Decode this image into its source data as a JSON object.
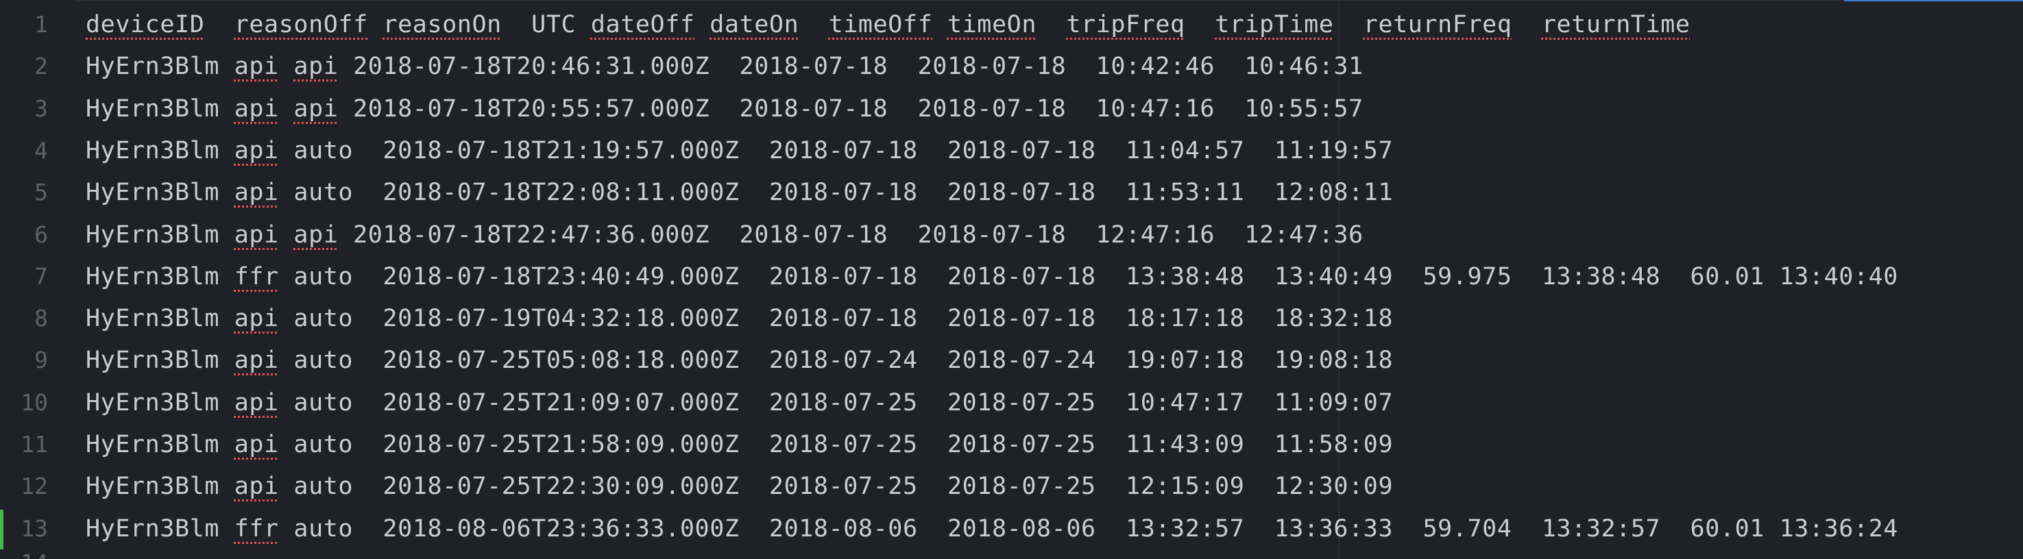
{
  "editor": {
    "lines": [
      {
        "num": "1",
        "modified": false,
        "tokens": [
          {
            "t": "deviceID",
            "s": true
          },
          {
            "t": "  ",
            "s": false
          },
          {
            "t": "reasonOff",
            "s": true
          },
          {
            "t": " ",
            "s": false
          },
          {
            "t": "reasonOn",
            "s": true
          },
          {
            "t": "  UTC ",
            "s": false
          },
          {
            "t": "dateOff",
            "s": true
          },
          {
            "t": " ",
            "s": false
          },
          {
            "t": "dateOn",
            "s": true
          },
          {
            "t": "  ",
            "s": false
          },
          {
            "t": "timeOff",
            "s": true
          },
          {
            "t": " ",
            "s": false
          },
          {
            "t": "timeOn",
            "s": true
          },
          {
            "t": "  ",
            "s": false
          },
          {
            "t": "tripFreq",
            "s": true
          },
          {
            "t": "  ",
            "s": false
          },
          {
            "t": "tripTime",
            "s": true
          },
          {
            "t": "  ",
            "s": false
          },
          {
            "t": "returnFreq",
            "s": true
          },
          {
            "t": "  ",
            "s": false
          },
          {
            "t": "returnTime",
            "s": true
          }
        ]
      },
      {
        "num": "2",
        "modified": false,
        "tokens": [
          {
            "t": "HyErn3Blm",
            "s": false
          },
          {
            "t": " ",
            "s": false
          },
          {
            "t": "api",
            "s": true
          },
          {
            "t": " ",
            "s": false
          },
          {
            "t": "api",
            "s": true
          },
          {
            "t": " 2018-07-18T20:46:31.000Z  2018-07-18  2018-07-18  10:42:46  10:46:31",
            "s": false
          }
        ]
      },
      {
        "num": "3",
        "modified": false,
        "tokens": [
          {
            "t": "HyErn3Blm",
            "s": false
          },
          {
            "t": " ",
            "s": false
          },
          {
            "t": "api",
            "s": true
          },
          {
            "t": " ",
            "s": false
          },
          {
            "t": "api",
            "s": true
          },
          {
            "t": " 2018-07-18T20:55:57.000Z  2018-07-18  2018-07-18  10:47:16  10:55:57",
            "s": false
          }
        ]
      },
      {
        "num": "4",
        "modified": false,
        "tokens": [
          {
            "t": "HyErn3Blm",
            "s": false
          },
          {
            "t": " ",
            "s": false
          },
          {
            "t": "api",
            "s": true
          },
          {
            "t": " auto  2018-07-18T21:19:57.000Z  2018-07-18  2018-07-18  11:04:57  11:19:57",
            "s": false
          }
        ]
      },
      {
        "num": "5",
        "modified": false,
        "tokens": [
          {
            "t": "HyErn3Blm",
            "s": false
          },
          {
            "t": " ",
            "s": false
          },
          {
            "t": "api",
            "s": true
          },
          {
            "t": " auto  2018-07-18T22:08:11.000Z  2018-07-18  2018-07-18  11:53:11  12:08:11",
            "s": false
          }
        ]
      },
      {
        "num": "6",
        "modified": false,
        "tokens": [
          {
            "t": "HyErn3Blm",
            "s": false
          },
          {
            "t": " ",
            "s": false
          },
          {
            "t": "api",
            "s": true
          },
          {
            "t": " ",
            "s": false
          },
          {
            "t": "api",
            "s": true
          },
          {
            "t": " 2018-07-18T22:47:36.000Z  2018-07-18  2018-07-18  12:47:16  12:47:36",
            "s": false
          }
        ]
      },
      {
        "num": "7",
        "modified": false,
        "tokens": [
          {
            "t": "HyErn3Blm",
            "s": false
          },
          {
            "t": " ",
            "s": false
          },
          {
            "t": "ffr",
            "s": true
          },
          {
            "t": " auto  2018-07-18T23:40:49.000Z  2018-07-18  2018-07-18  13:38:48  13:40:49  59.975  13:38:48  60.01 13:40:40",
            "s": false
          }
        ]
      },
      {
        "num": "8",
        "modified": false,
        "tokens": [
          {
            "t": "HyErn3Blm",
            "s": false
          },
          {
            "t": " ",
            "s": false
          },
          {
            "t": "api",
            "s": true
          },
          {
            "t": " auto  2018-07-19T04:32:18.000Z  2018-07-18  2018-07-18  18:17:18  18:32:18",
            "s": false
          }
        ]
      },
      {
        "num": "9",
        "modified": false,
        "tokens": [
          {
            "t": "HyErn3Blm",
            "s": false
          },
          {
            "t": " ",
            "s": false
          },
          {
            "t": "api",
            "s": true
          },
          {
            "t": " auto  2018-07-25T05:08:18.000Z  2018-07-24  2018-07-24  19:07:18  19:08:18",
            "s": false
          }
        ]
      },
      {
        "num": "10",
        "modified": false,
        "tokens": [
          {
            "t": "HyErn3Blm",
            "s": false
          },
          {
            "t": " ",
            "s": false
          },
          {
            "t": "api",
            "s": true
          },
          {
            "t": " auto  2018-07-25T21:09:07.000Z  2018-07-25  2018-07-25  10:47:17  11:09:07",
            "s": false
          }
        ]
      },
      {
        "num": "11",
        "modified": false,
        "tokens": [
          {
            "t": "HyErn3Blm",
            "s": false
          },
          {
            "t": " ",
            "s": false
          },
          {
            "t": "api",
            "s": true
          },
          {
            "t": " auto  2018-07-25T21:58:09.000Z  2018-07-25  2018-07-25  11:43:09  11:58:09",
            "s": false
          }
        ]
      },
      {
        "num": "12",
        "modified": false,
        "tokens": [
          {
            "t": "HyErn3Blm",
            "s": false
          },
          {
            "t": " ",
            "s": false
          },
          {
            "t": "api",
            "s": true
          },
          {
            "t": " auto  2018-07-25T22:30:09.000Z  2018-07-25  2018-07-25  12:15:09  12:30:09",
            "s": false
          }
        ]
      },
      {
        "num": "13",
        "modified": true,
        "tokens": [
          {
            "t": "HyErn3Blm",
            "s": false
          },
          {
            "t": " ",
            "s": false
          },
          {
            "t": "ffr",
            "s": true
          },
          {
            "t": " auto  2018-08-06T23:36:33.000Z  2018-08-06  2018-08-06  13:32:57  13:36:33  59.704  13:32:57  60.01 13:36:24",
            "s": false
          }
        ]
      }
    ],
    "partial_line_num": "14"
  },
  "colors": {
    "background": "#1f2126",
    "text": "#c9ccd2",
    "line_number": "#5d626b",
    "spellcheck_underline": "#e05252",
    "git_modified": "#3fb950",
    "accent": "#3a7bd5"
  }
}
